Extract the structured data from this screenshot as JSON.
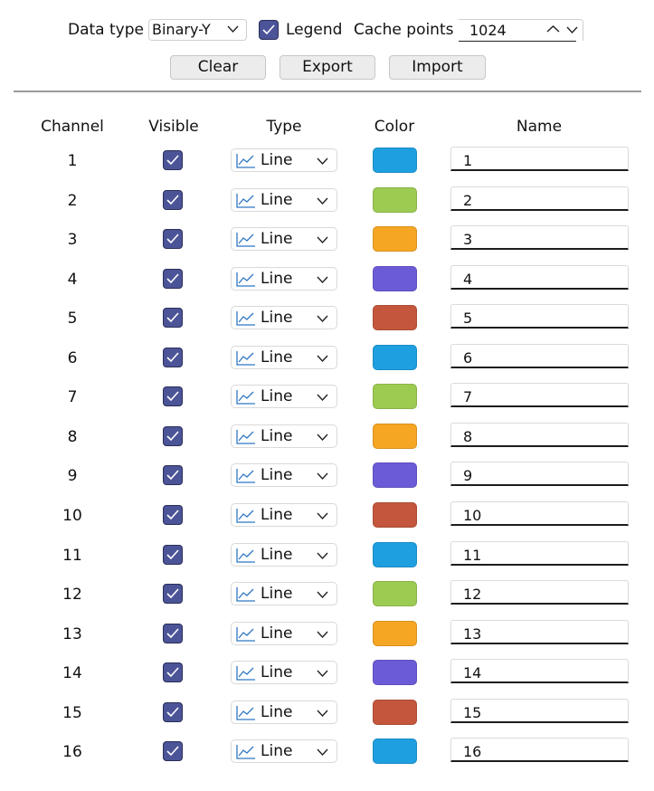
{
  "toolbar": {
    "data_type_label": "Data type",
    "data_type_value": "Binary-Y",
    "legend_label": "Legend",
    "legend_checked": true,
    "cache_points_label": "Cache points",
    "cache_points_value": "1024",
    "clear_label": "Clear",
    "export_label": "Export",
    "import_label": "Import"
  },
  "table": {
    "headers": [
      "Channel",
      "Visible",
      "Type",
      "Color",
      "Name"
    ],
    "rows": [
      {
        "channel": "1",
        "visible": true,
        "type": "Line",
        "color": "#1e9fe0",
        "name": "1"
      },
      {
        "channel": "2",
        "visible": true,
        "type": "Line",
        "color": "#9ccb52",
        "name": "2"
      },
      {
        "channel": "3",
        "visible": true,
        "type": "Line",
        "color": "#f5a623",
        "name": "3"
      },
      {
        "channel": "4",
        "visible": true,
        "type": "Line",
        "color": "#6b5bd6",
        "name": "4"
      },
      {
        "channel": "5",
        "visible": true,
        "type": "Line",
        "color": "#c3563c",
        "name": "5"
      },
      {
        "channel": "6",
        "visible": true,
        "type": "Line",
        "color": "#1e9fe0",
        "name": "6"
      },
      {
        "channel": "7",
        "visible": true,
        "type": "Line",
        "color": "#9ccb52",
        "name": "7"
      },
      {
        "channel": "8",
        "visible": true,
        "type": "Line",
        "color": "#f5a623",
        "name": "8"
      },
      {
        "channel": "9",
        "visible": true,
        "type": "Line",
        "color": "#6b5bd6",
        "name": "9"
      },
      {
        "channel": "10",
        "visible": true,
        "type": "Line",
        "color": "#c3563c",
        "name": "10"
      },
      {
        "channel": "11",
        "visible": true,
        "type": "Line",
        "color": "#1e9fe0",
        "name": "11"
      },
      {
        "channel": "12",
        "visible": true,
        "type": "Line",
        "color": "#9ccb52",
        "name": "12"
      },
      {
        "channel": "13",
        "visible": true,
        "type": "Line",
        "color": "#f5a623",
        "name": "13"
      },
      {
        "channel": "14",
        "visible": true,
        "type": "Line",
        "color": "#6b5bd6",
        "name": "14"
      },
      {
        "channel": "15",
        "visible": true,
        "type": "Line",
        "color": "#c3563c",
        "name": "15"
      },
      {
        "channel": "16",
        "visible": true,
        "type": "Line",
        "color": "#1e9fe0",
        "name": "16"
      }
    ]
  },
  "icons": {
    "checkbox": "checkmark-icon",
    "type": "line-chart-icon",
    "dropdown": "chevron-down-icon",
    "spinner_up": "chevron-up-icon"
  }
}
